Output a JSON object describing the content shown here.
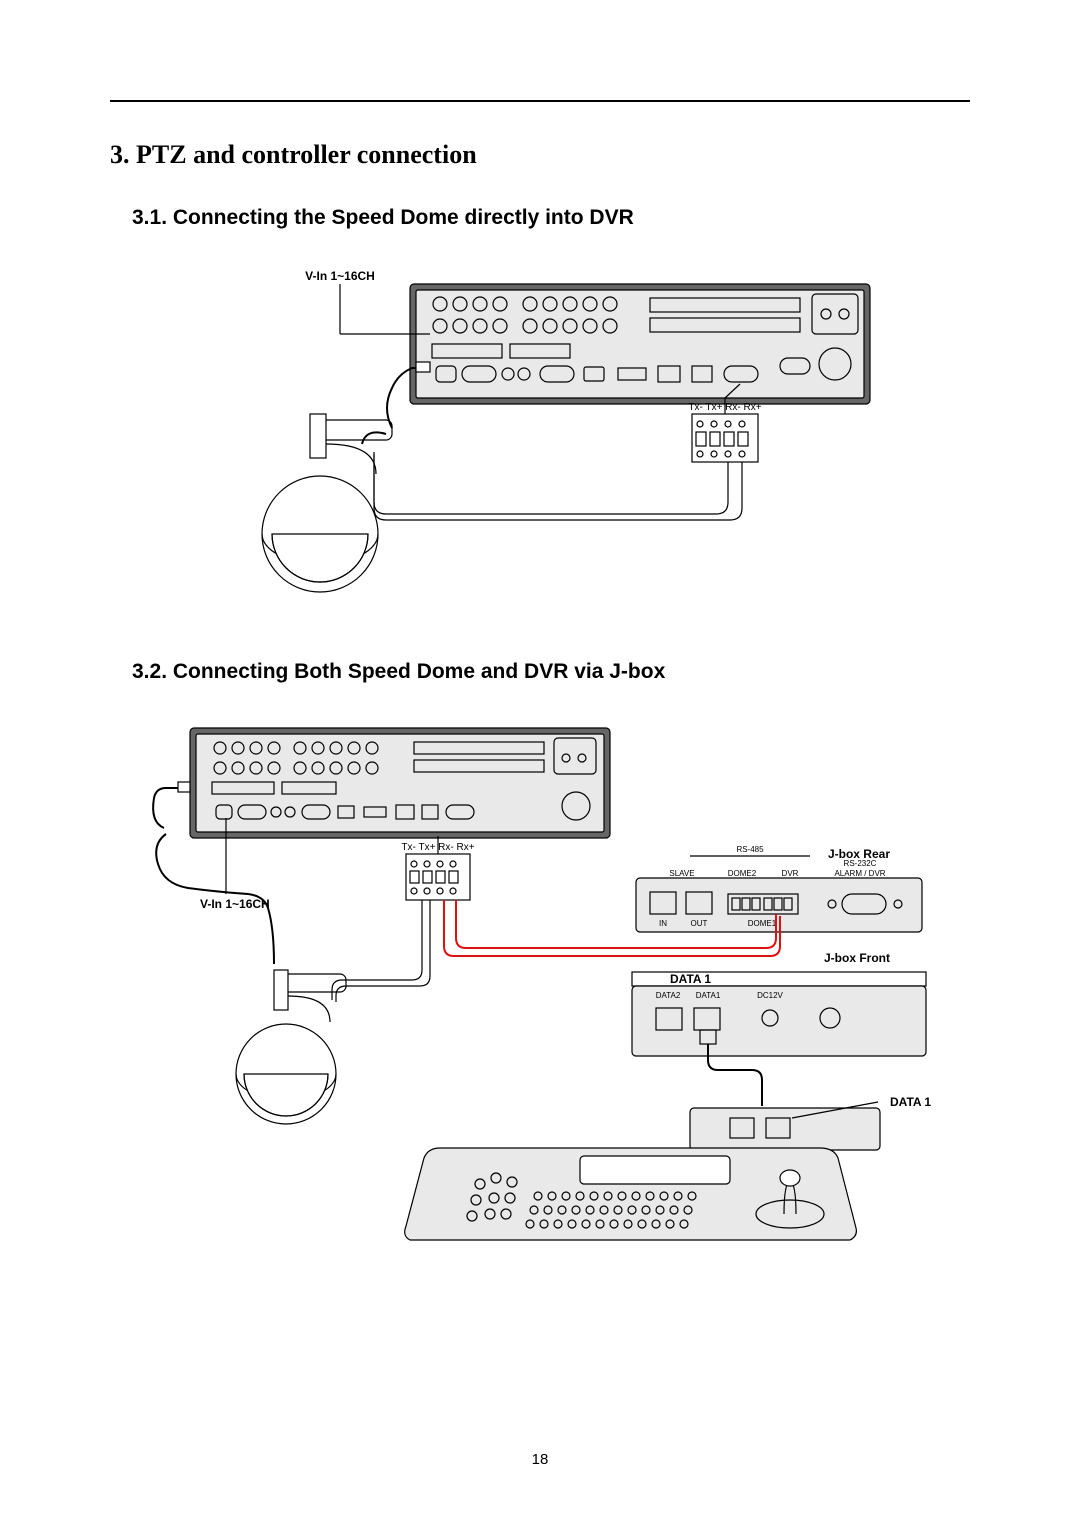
{
  "page_number": "18",
  "section": {
    "title": "3. PTZ and controller connection",
    "sub_31_title": "3.1. Connecting the Speed Dome directly into DVR",
    "sub_32_title": "3.2. Connecting Both Speed Dome and DVR via J-box"
  },
  "diagram31": {
    "vin_label": "V-In  1~16CH",
    "terminal_labels": "Tx- Tx+ Rx- Rx+"
  },
  "diagram32": {
    "vin_label": "V-In  1~16CH",
    "terminal_labels": "Tx- Tx+ Rx- Rx+",
    "jbox_rear_label": "J-box Rear",
    "jbox_front_label": "J-box Front",
    "rs485_label": "RS-485",
    "rs232c_label": "RS-232C",
    "alarm_dvr_label": "ALARM / DVR",
    "dome1_label": "DOME1",
    "dome2_label": "DOME2",
    "dvr_label": "DVR",
    "slave_label": "SLAVE",
    "in_label": "IN",
    "out_label": "OUT",
    "data1_upper": "DATA 1",
    "data1_lower": "DATA 1",
    "data2_label": "DATA2",
    "data1_small": "DATA1",
    "dc12v_label": "DC12V"
  }
}
